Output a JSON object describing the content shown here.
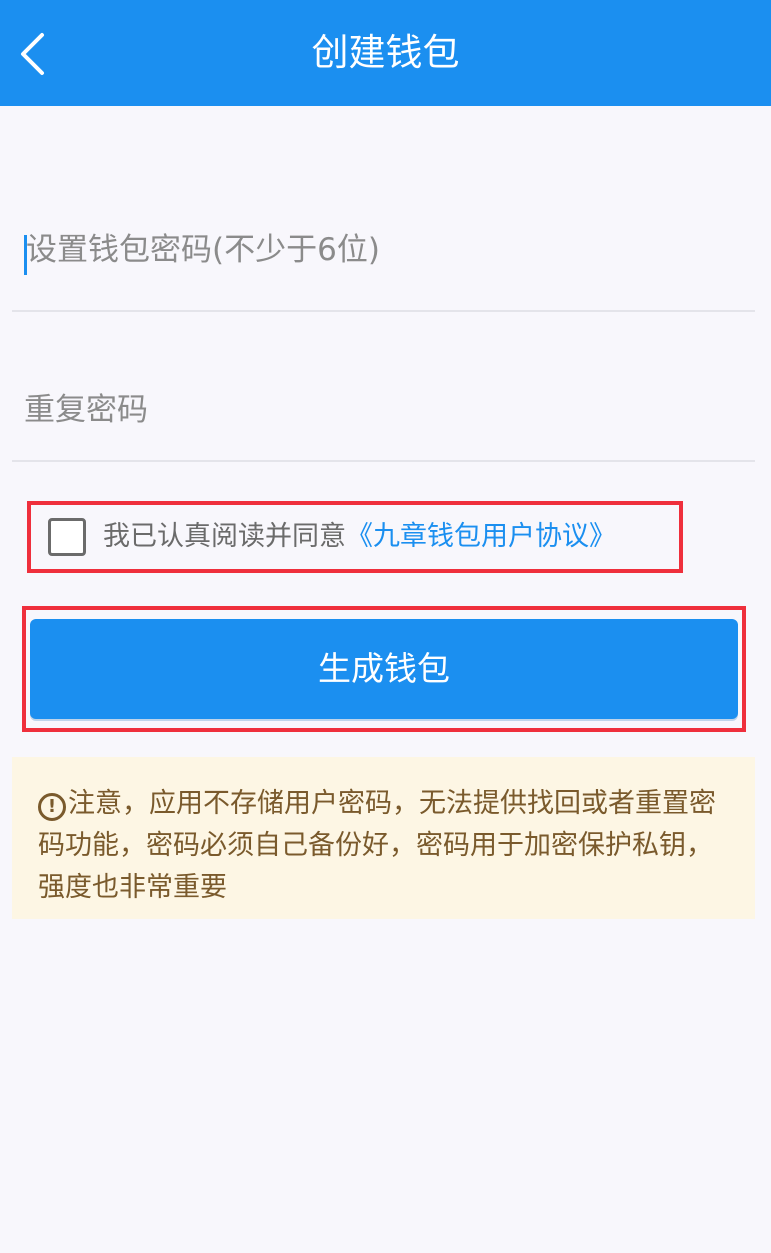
{
  "header": {
    "title": "创建钱包",
    "back_icon": "chevron-left-icon"
  },
  "form": {
    "password_placeholder": "设置钱包密码(不少于6位)",
    "repeat_placeholder": "重复密码"
  },
  "agreement": {
    "checked": false,
    "prefix": "我已认真阅读并同意",
    "link": "《九章钱包用户协议》"
  },
  "submit": {
    "label": "生成钱包"
  },
  "notice": {
    "icon": "alert-circle-icon",
    "text": "注意，应用不存储用户密码，无法提供找回或者重置密码功能，密码必须自己备份好，密码用于加密保护私钥，强度也非常重要"
  },
  "colors": {
    "primary": "#1b8ff0",
    "highlight": "#ef2f3c",
    "notice_bg": "#fdf6e4",
    "notice_text": "#7a5a2c"
  }
}
